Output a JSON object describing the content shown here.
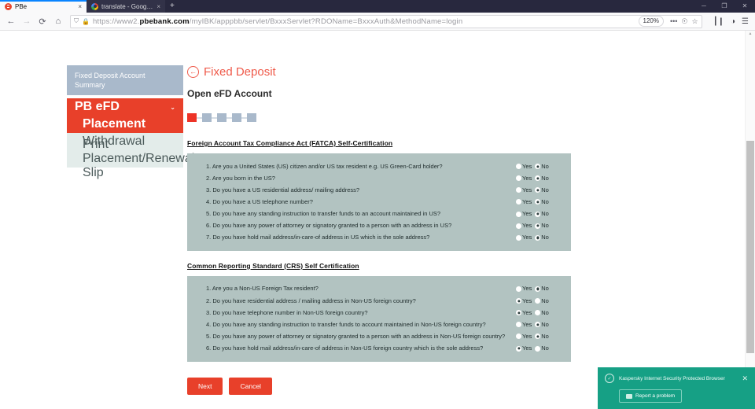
{
  "browser": {
    "tabs": [
      {
        "title": "PBe",
        "favicon": "pbe-favicon",
        "active": true,
        "close_label": "×"
      },
      {
        "title": "translate - Google S",
        "favicon": "google-favicon",
        "active": false,
        "close_label": "×"
      }
    ],
    "new_tab_label": "+",
    "window_controls": {
      "minimize": "─",
      "restore": "❐",
      "close": "✕"
    },
    "nav": {
      "back": "←",
      "forward": "→",
      "reload": "⟳",
      "home": "⌂"
    },
    "url": {
      "shield_icon": "⛉",
      "lock_icon": "🔒",
      "scheme": "https://www2.",
      "domain": "pbebank.com",
      "path": "/myIBK/apppbb/servlet/BxxxServlet?RDOName=BxxxAuth&MethodName=login",
      "zoom_level": "120%",
      "more_icon": "•••",
      "reader_icon": "☉",
      "bookmark_icon": "☆"
    },
    "toolbar_right": {
      "library_icon": "┃❙",
      "account_icon": "◑",
      "menu_icon": "☰"
    },
    "scrollbar": {
      "up_arrow": "▲"
    }
  },
  "sidebar": {
    "items": [
      {
        "label": "Fixed Deposit Account Summary",
        "style": "summary"
      },
      {
        "label": "PB eFD",
        "style": "group",
        "chevron": "⌄"
      },
      {
        "label": "Placement",
        "style": "sub-active"
      },
      {
        "label": "Withdrawal",
        "style": "sub"
      },
      {
        "label": "Print Placement/Renewal Slip",
        "style": "sub"
      }
    ]
  },
  "main": {
    "back_icon": "←",
    "breadcrumb_title": "Fixed Deposit",
    "page_title": "Open eFD Account",
    "stepper": {
      "total": 5,
      "current": 1
    },
    "fatca": {
      "heading": "Foreign Account Tax Compliance Act (FATCA) Self-Certification",
      "yes_label": "Yes",
      "no_label": "No",
      "questions": [
        {
          "num": "1.",
          "text": "Are you a United States (US) citizen and/or US tax resident e.g. US Green-Card holder?",
          "answer": "No"
        },
        {
          "num": "2.",
          "text": "Are you born in the US?",
          "answer": "No"
        },
        {
          "num": "3.",
          "text": "Do you have a US residential address/ mailing address?",
          "answer": "No"
        },
        {
          "num": "4.",
          "text": "Do you have a US telephone number?",
          "answer": "No"
        },
        {
          "num": "5.",
          "text": "Do you have any standing instruction to transfer funds to an account maintained in US?",
          "answer": "No"
        },
        {
          "num": "6.",
          "text": "Do you have any power of attorney or signatory granted to a person with an address in US?",
          "answer": "No"
        },
        {
          "num": "7.",
          "text": "Do you have hold mail address/in-care-of address in US which is the sole address?",
          "answer": "No"
        }
      ]
    },
    "crs": {
      "heading": "Common Reporting Standard (CRS) Self Certification",
      "yes_label": "Yes",
      "no_label": "No",
      "questions": [
        {
          "num": "1.",
          "text": "Are you a Non-US Foreign Tax resident?",
          "answer": "No"
        },
        {
          "num": "2.",
          "text": "Do you have residential address / mailing address in Non-US foreign country?",
          "answer": "Yes"
        },
        {
          "num": "3.",
          "text": "Do you have telephone number in Non-US foreign country?",
          "answer": "Yes"
        },
        {
          "num": "4.",
          "text": "Do you have any standing instruction to transfer funds to account maintained in Non-US foreign country?",
          "answer": "No"
        },
        {
          "num": "5.",
          "text": "Do you have any power of attorney or signatory granted to a person with an address in Non-US foreign country?",
          "answer": "No"
        },
        {
          "num": "6.",
          "text": "Do you have hold mail address/in-care-of address in Non-US foreign country which is the sole address?",
          "answer": "Yes"
        }
      ]
    },
    "buttons": {
      "next": "Next",
      "cancel": "Cancel"
    }
  },
  "toast": {
    "shield_icon": "✓",
    "message": "Kaspersky Internet Security Protected Browser",
    "close_label": "✕",
    "report_label": "Report a problem"
  },
  "colors": {
    "brand_red": "#e8402a",
    "title_red": "#ef5a4a",
    "panel_bg": "#b2c3c1",
    "summary_blue": "#a9b9cb",
    "toast_green": "#16a085"
  }
}
